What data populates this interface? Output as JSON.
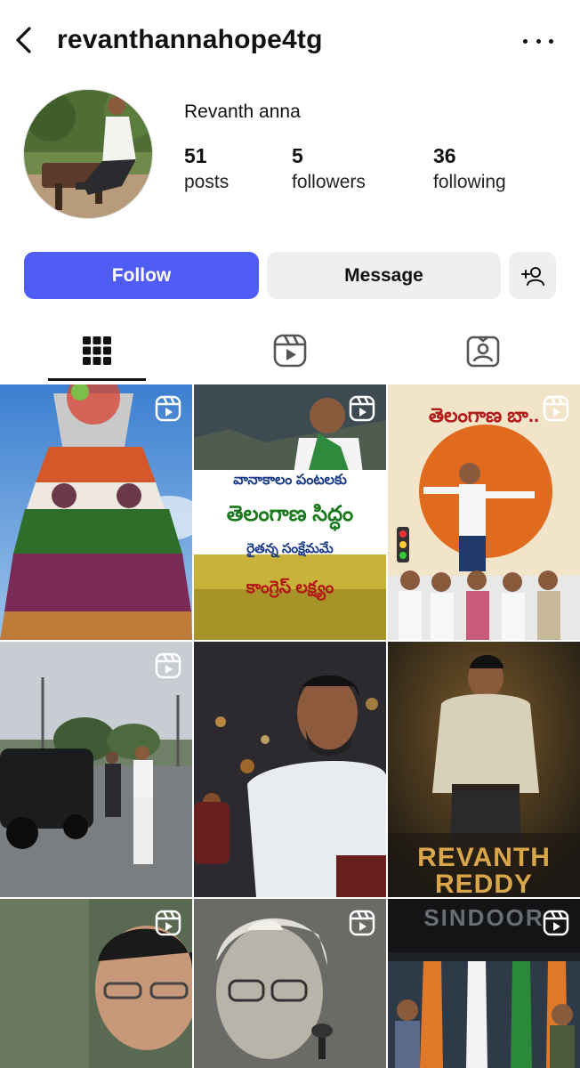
{
  "header": {
    "username": "revanthannahope4tg"
  },
  "profile": {
    "display_name": "Revanth anna",
    "stats": {
      "posts_count": "51",
      "posts_label": "posts",
      "followers_count": "5",
      "followers_label": "followers",
      "following_count": "36",
      "following_label": "following"
    }
  },
  "actions": {
    "follow_label": "Follow",
    "message_label": "Message"
  },
  "tabs": [
    {
      "icon": "grid-icon",
      "active": true
    },
    {
      "icon": "reels-icon",
      "active": false
    },
    {
      "icon": "tagged-icon",
      "active": false
    }
  ],
  "posts": [
    {
      "type": "reel",
      "text": []
    },
    {
      "type": "reel",
      "text": [
        "వానాకాలం పంటలకు",
        "తెలంగాణ సిద్ధం",
        "రైతన్న సంక్షేమమే",
        "కాంగ్రెస్ లక్ష్యం"
      ]
    },
    {
      "type": "reel",
      "text": [
        "తెలంగాణ బా.."
      ]
    },
    {
      "type": "reel",
      "text": []
    },
    {
      "type": "photo",
      "text": []
    },
    {
      "type": "photo",
      "text": [
        "REVANTH",
        "REDDY"
      ]
    },
    {
      "type": "reel",
      "text": []
    },
    {
      "type": "reel",
      "text": []
    },
    {
      "type": "reel",
      "text": [
        "SINDOOR"
      ]
    }
  ],
  "colors": {
    "follow_button": "#4f5cf5",
    "secondary_button": "#efeff1",
    "text": "#111111"
  }
}
